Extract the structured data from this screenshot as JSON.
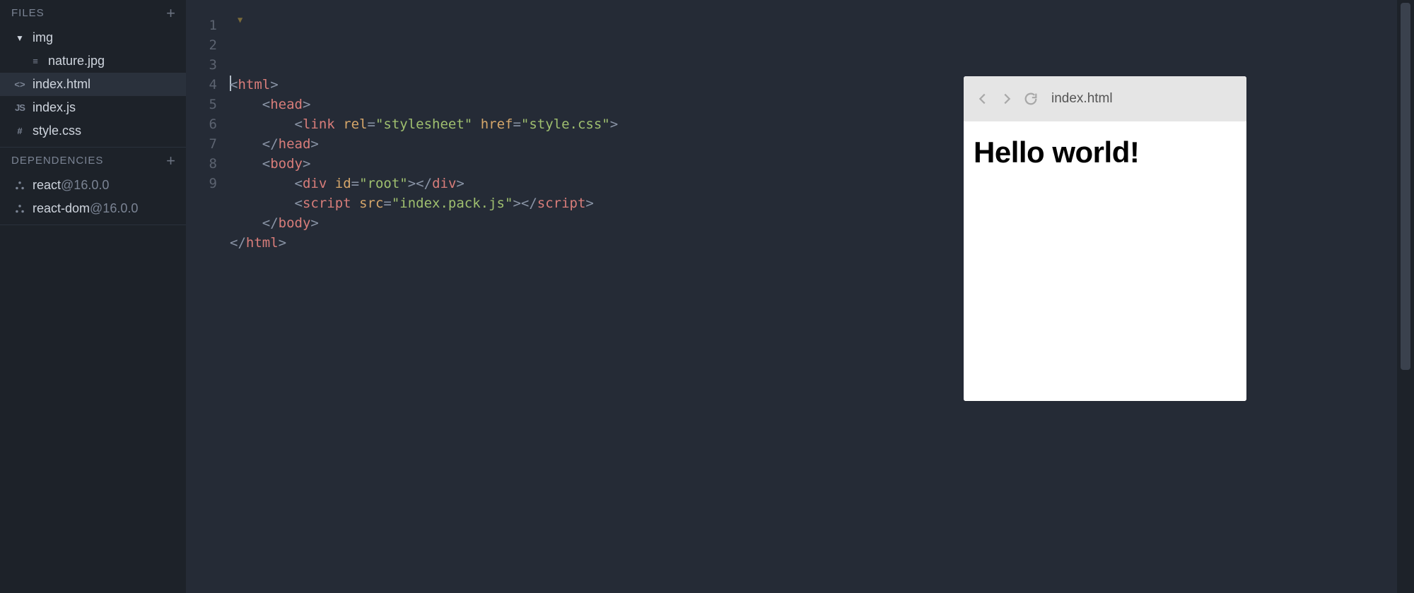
{
  "sidebar": {
    "files_header": "FILES",
    "deps_header": "DEPENDENCIES",
    "folder": {
      "name": "img"
    },
    "files": [
      {
        "icon": "file",
        "name": "nature.jpg",
        "indent": true,
        "active": false
      },
      {
        "icon": "html",
        "name": "index.html",
        "indent": false,
        "active": true
      },
      {
        "icon": "js",
        "name": "index.js",
        "indent": false,
        "active": false
      },
      {
        "icon": "css",
        "name": "style.css",
        "indent": false,
        "active": false
      }
    ],
    "deps": [
      {
        "name": "react",
        "version": "@16.0.0"
      },
      {
        "name": "react-dom",
        "version": "@16.0.0"
      }
    ]
  },
  "editor": {
    "lines": [
      [
        {
          "c": "p",
          "t": "<"
        },
        {
          "c": "t",
          "t": "html"
        },
        {
          "c": "p",
          "t": ">"
        }
      ],
      [
        {
          "c": "",
          "t": "    "
        },
        {
          "c": "p",
          "t": "<"
        },
        {
          "c": "t",
          "t": "head"
        },
        {
          "c": "p",
          "t": ">"
        }
      ],
      [
        {
          "c": "",
          "t": "        "
        },
        {
          "c": "p",
          "t": "<"
        },
        {
          "c": "t",
          "t": "link"
        },
        {
          "c": "",
          "t": " "
        },
        {
          "c": "a",
          "t": "rel"
        },
        {
          "c": "p",
          "t": "="
        },
        {
          "c": "s",
          "t": "\"stylesheet\""
        },
        {
          "c": "",
          "t": " "
        },
        {
          "c": "a",
          "t": "href"
        },
        {
          "c": "p",
          "t": "="
        },
        {
          "c": "s",
          "t": "\"style.css\""
        },
        {
          "c": "p",
          "t": ">"
        }
      ],
      [
        {
          "c": "",
          "t": "    "
        },
        {
          "c": "p",
          "t": "</"
        },
        {
          "c": "t",
          "t": "head"
        },
        {
          "c": "p",
          "t": ">"
        }
      ],
      [
        {
          "c": "",
          "t": "    "
        },
        {
          "c": "p",
          "t": "<"
        },
        {
          "c": "t",
          "t": "body"
        },
        {
          "c": "p",
          "t": ">"
        }
      ],
      [
        {
          "c": "",
          "t": "        "
        },
        {
          "c": "p",
          "t": "<"
        },
        {
          "c": "t",
          "t": "div"
        },
        {
          "c": "",
          "t": " "
        },
        {
          "c": "a",
          "t": "id"
        },
        {
          "c": "p",
          "t": "="
        },
        {
          "c": "s",
          "t": "\"root\""
        },
        {
          "c": "p",
          "t": "></"
        },
        {
          "c": "t",
          "t": "div"
        },
        {
          "c": "p",
          "t": ">"
        }
      ],
      [
        {
          "c": "",
          "t": "        "
        },
        {
          "c": "p",
          "t": "<"
        },
        {
          "c": "t",
          "t": "script"
        },
        {
          "c": "",
          "t": " "
        },
        {
          "c": "a",
          "t": "src"
        },
        {
          "c": "p",
          "t": "="
        },
        {
          "c": "s",
          "t": "\"index.pack.js\""
        },
        {
          "c": "p",
          "t": "></"
        },
        {
          "c": "t",
          "t": "script"
        },
        {
          "c": "p",
          "t": ">"
        }
      ],
      [
        {
          "c": "",
          "t": "    "
        },
        {
          "c": "p",
          "t": "</"
        },
        {
          "c": "t",
          "t": "body"
        },
        {
          "c": "p",
          "t": ">"
        }
      ],
      [
        {
          "c": "p",
          "t": "</"
        },
        {
          "c": "t",
          "t": "html"
        },
        {
          "c": "p",
          "t": ">"
        }
      ]
    ]
  },
  "preview": {
    "title": "index.html",
    "heading": "Hello world!"
  }
}
